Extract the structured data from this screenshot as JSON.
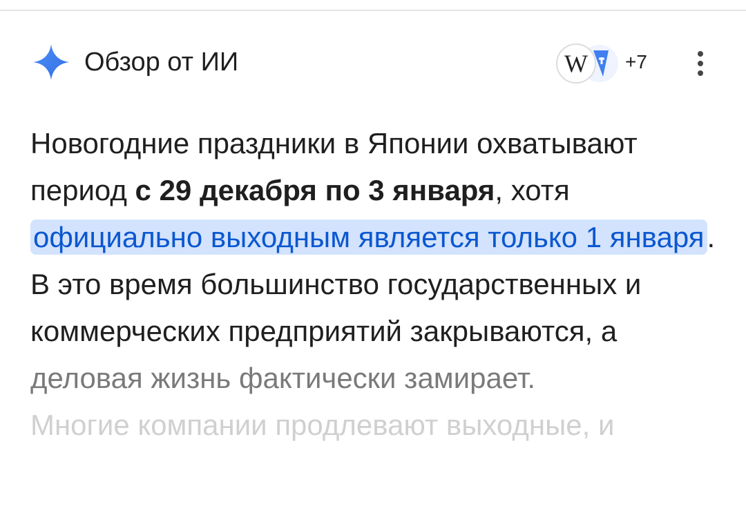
{
  "header": {
    "title": "Обзор от ИИ",
    "sources_more": "+7",
    "source_icons": [
      "wikipedia-icon",
      "translate-icon"
    ]
  },
  "body": {
    "p1": "Новогодние праздники в Японии охватывают период ",
    "bold_period": "с 29 декабря по 3 января",
    "p2": ", хотя ",
    "highlight": "официально выходным является только 1 января",
    "p3": ". В это время большинство государственных и коммерческих предприятий закрываются, а",
    "faded_line": "деловая жизнь фактически замирает.",
    "faded_line2": "Многие компании продлевают выходные, и"
  },
  "colors": {
    "accent": "#4285f4",
    "highlight_bg": "#d3e3fd",
    "highlight_text": "#0b57d0"
  }
}
